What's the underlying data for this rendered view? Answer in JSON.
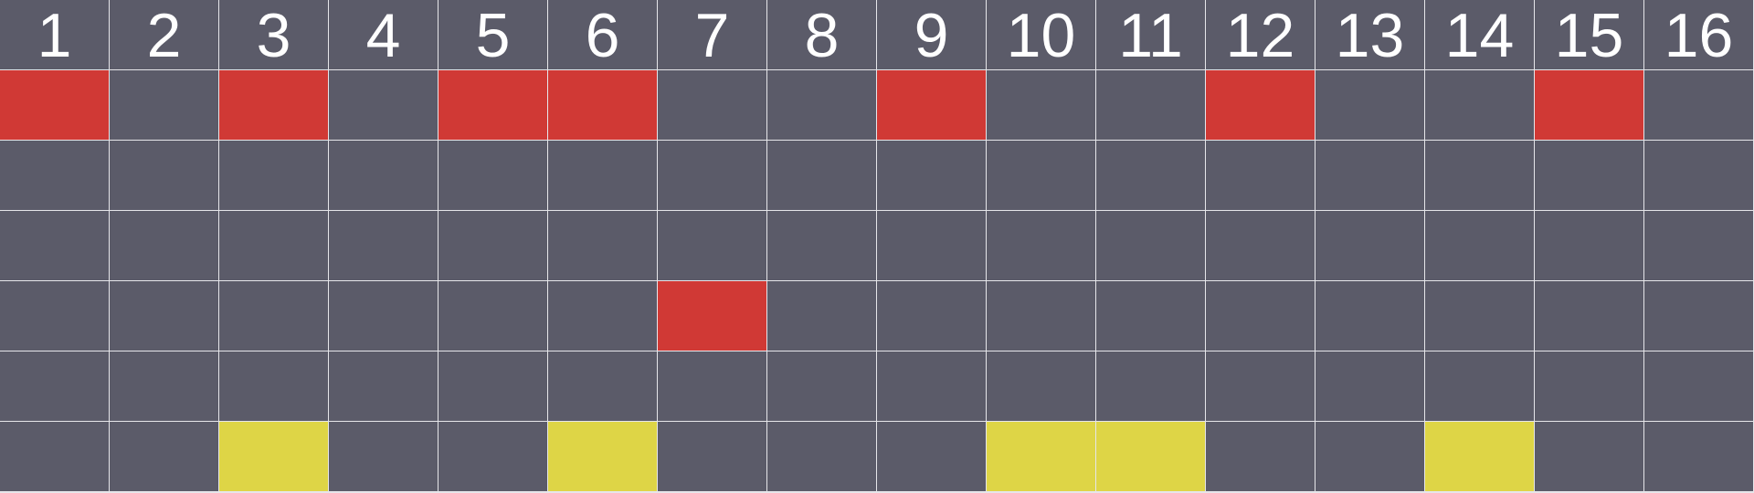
{
  "step_numbers": [
    "1",
    "2",
    "3",
    "4",
    "5",
    "6",
    "7",
    "8",
    "9",
    "10",
    "11",
    "12",
    "13",
    "14",
    "15",
    "16"
  ],
  "colors": {
    "off": "#5b5b69",
    "red": "#d03935",
    "yellow": "#ded546",
    "gridline": "#e6e6ea",
    "header_text": "#ffffff"
  },
  "rows": [
    {
      "color": "red",
      "active": [
        1,
        3,
        5,
        6,
        9,
        12,
        15
      ]
    },
    {
      "color": "red",
      "active": []
    },
    {
      "color": "red",
      "active": []
    },
    {
      "color": "red",
      "active": [
        7
      ]
    },
    {
      "color": "red",
      "active": []
    },
    {
      "color": "yellow",
      "active": [
        3,
        6,
        10,
        11,
        14
      ]
    }
  ]
}
